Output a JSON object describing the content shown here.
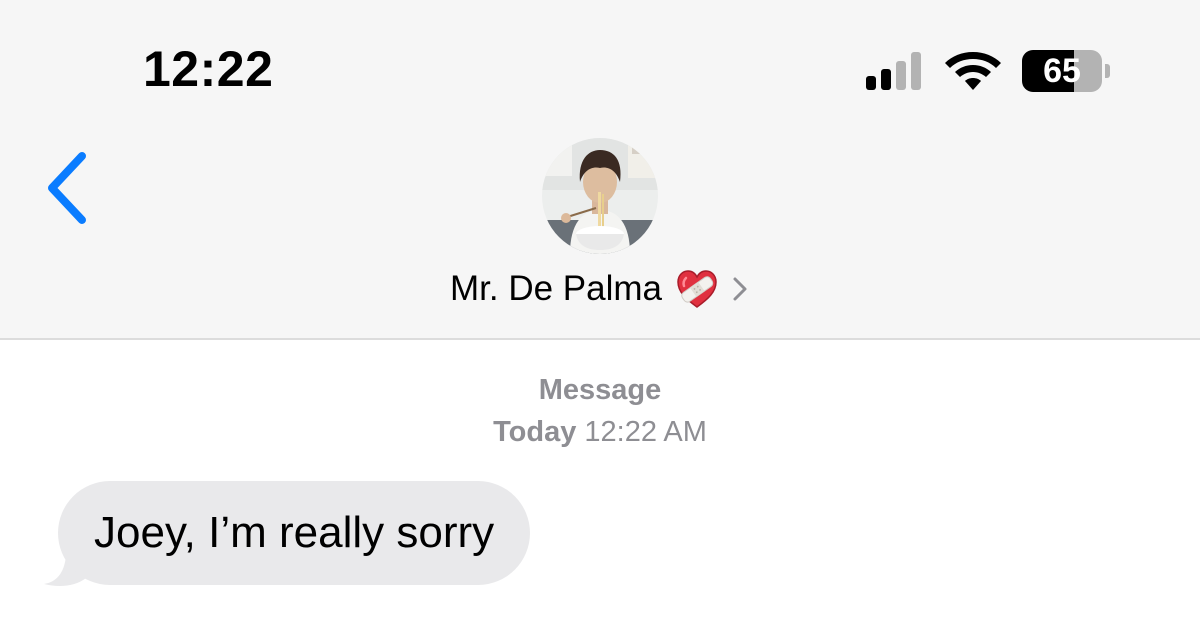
{
  "status_bar": {
    "time": "12:22",
    "battery_level": "65",
    "battery_fraction": 0.65,
    "signal_bars_active": 2,
    "signal_bars_total": 4
  },
  "header": {
    "back_icon": "chevron-left-icon",
    "contact_name": "Mr. De Palma",
    "contact_emoji": "mending-heart-icon",
    "details_icon": "chevron-right-icon"
  },
  "conversation": {
    "service_label": "Message",
    "day_label": "Today",
    "time_label": "12:22 AM",
    "messages": [
      {
        "direction": "incoming",
        "text": "Joey, I’m really sorry"
      }
    ]
  },
  "colors": {
    "accent": "#0a7cff",
    "header_bg": "#f6f6f6",
    "bubble_incoming": "#e9e9eb",
    "meta_text": "#8e8e93"
  }
}
